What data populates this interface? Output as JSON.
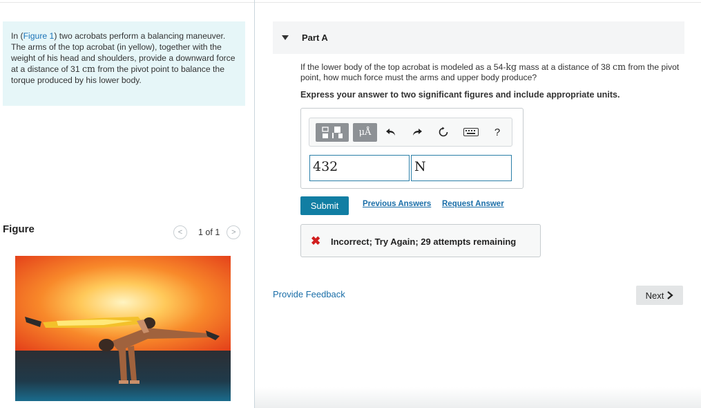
{
  "problem": {
    "text_1": "In (",
    "figure_link": "Figure 1",
    "text_2": ") two acrobats perform a balancing maneuver. The arms of the top acrobat (in yellow), together with the weight of his head and shoulders, provide a downward force at a distance of 31 ",
    "unit": "cm",
    "text_3": " from the pivot point to balance the torque produced by his lower body."
  },
  "figure": {
    "label": "Figure",
    "pager_text": "1 of 1",
    "prev_glyph": "<",
    "next_glyph": ">"
  },
  "part": {
    "title": "Part A",
    "question_1": "If the lower body of the top acrobat is modeled as a 54-",
    "question_unit_kg": "kg",
    "question_2": " mass at a distance of 38 ",
    "question_unit_cm": "cm",
    "question_3": " from the pivot point, how much force must the arms and upper body produce?",
    "instruction": "Express your answer to two significant figures and include appropriate units."
  },
  "toolbar": {
    "units_label": "μÅ",
    "undo_icon": "undo-icon",
    "redo_icon": "redo-icon",
    "reset_icon": "reset-icon",
    "keyboard_icon": "keyboard-icon",
    "help_label": "?"
  },
  "answer": {
    "value": "432",
    "unit": "N"
  },
  "actions": {
    "submit": "Submit",
    "previous_answers": "Previous Answers",
    "request_answer": "Request Answer"
  },
  "feedback": {
    "icon": "✖",
    "message": "Incorrect; Try Again; 29 attempts remaining"
  },
  "footer": {
    "provide_feedback": "Provide Feedback",
    "next": "Next"
  },
  "colors": {
    "accent": "#117ea3",
    "link": "#1a6ea8",
    "error": "#d11e1e",
    "problem_bg": "#e6f6f8"
  }
}
